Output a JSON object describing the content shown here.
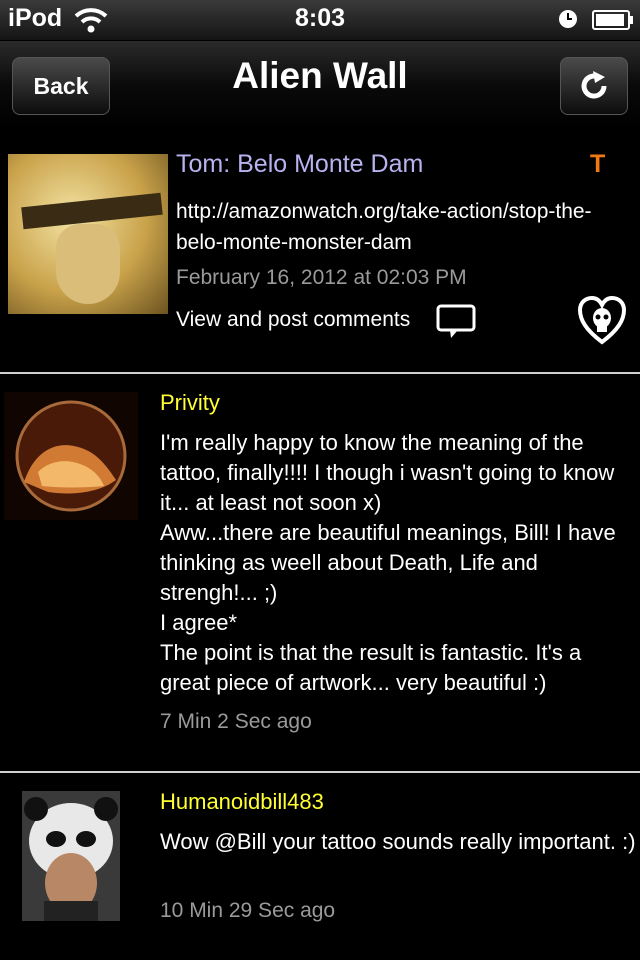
{
  "status_bar": {
    "carrier": "iPod",
    "time": "8:03"
  },
  "nav": {
    "back_label": "Back",
    "title": "Alien Wall"
  },
  "post": {
    "title": "Tom: Belo Monte Dam",
    "tag": "T",
    "link": "http://amazonwatch.org/take-action/stop-the-belo-monte-monster-dam",
    "date": "February 16, 2012 at 02:03 PM",
    "comments_label": "View and post comments"
  },
  "comments": [
    {
      "author": "Privity",
      "text": "I'm really happy to know the meaning of the tattoo, finally!!!! I though i wasn't going to know it... at least not soon x)\nAww...there are beautiful meanings, Bill! I have thinking as weell about Death, Life and strengh!... ;)\nI agree*\nThe point is that the result is fantastic. It's a great piece of artwork... very beautiful :)",
      "time": "7 Min 2 Sec ago"
    },
    {
      "author": "Humanoidbill483",
      "text": "Wow @Bill your tattoo sounds really important. :)",
      "time": "10 Min 29 Sec ago"
    }
  ]
}
